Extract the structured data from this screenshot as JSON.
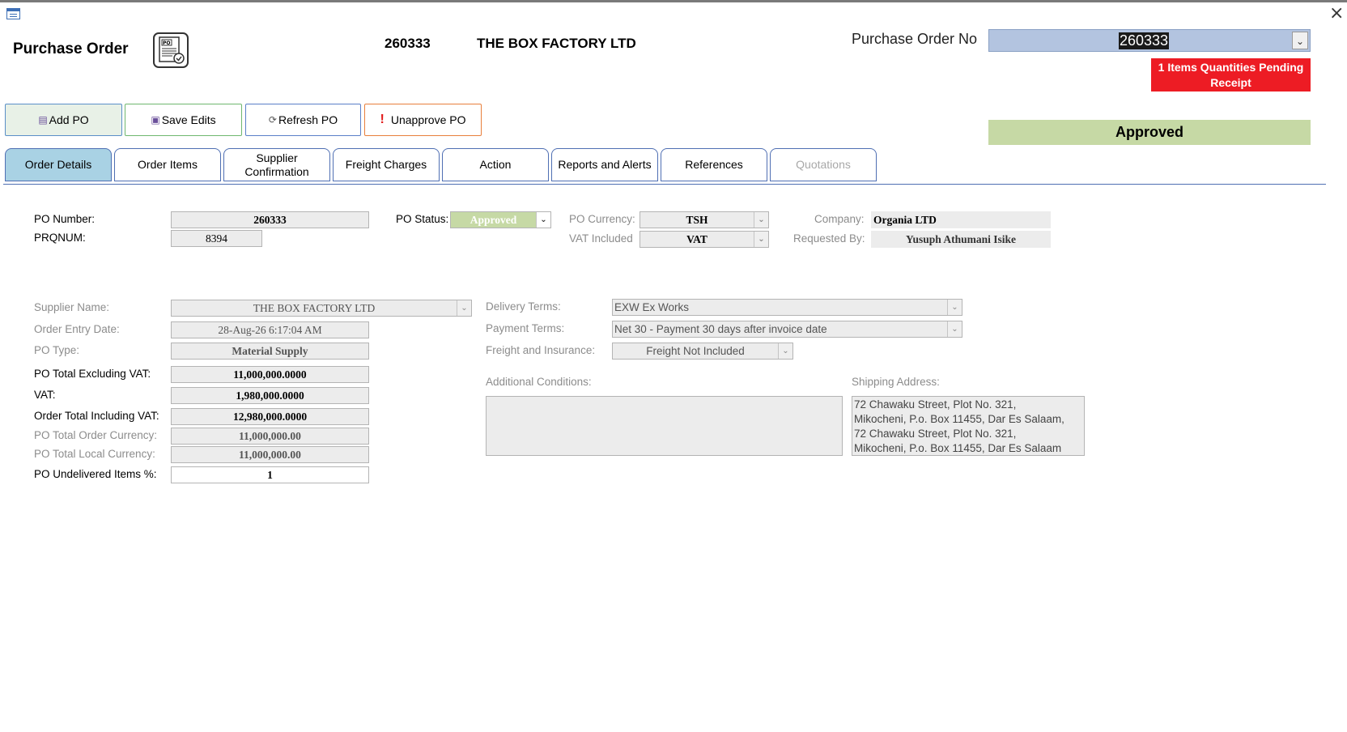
{
  "window": {
    "close_icon": "close-icon"
  },
  "header": {
    "title": "Purchase Order",
    "po_number": "260333",
    "supplier": "THE BOX FACTORY LTD",
    "po_no_label": "Purchase Order No",
    "po_no_value": "260333",
    "pending_alert": "1 Items Quantities Pending Receipt",
    "status_banner": "Approved"
  },
  "toolbar": {
    "add": "Add PO",
    "save": "Save Edits",
    "refresh": "Refresh PO",
    "unapprove": "Unapprove PO"
  },
  "tabs": [
    {
      "label": "Order Details",
      "active": true
    },
    {
      "label": "Order Items"
    },
    {
      "label": "Supplier Confirmation"
    },
    {
      "label": "Freight Charges"
    },
    {
      "label": "Action"
    },
    {
      "label": "Reports and Alerts"
    },
    {
      "label": "References"
    },
    {
      "label": "Quotations",
      "disabled": true
    }
  ],
  "details": {
    "po_number_label": "PO Number:",
    "po_number_value": "260333",
    "prqnum_label": "PRQNUM:",
    "prqnum_value": "8394",
    "po_status_label": "PO Status:",
    "po_status_value": "Approved",
    "po_currency_label": "PO Currency:",
    "po_currency_value": "TSH",
    "vat_included_label": "VAT Included",
    "vat_included_value": "VAT",
    "company_label": "Company:",
    "company_value": "Organia LTD",
    "requested_by_label": "Requested By:",
    "requested_by_value": "Yusuph Athumani Isike",
    "supplier_name_label": "Supplier Name:",
    "supplier_name_value": "THE BOX FACTORY LTD",
    "order_entry_date_label": "Order Entry Date:",
    "order_entry_date_value": "28-Aug-26 6:17:04 AM",
    "po_type_label": "PO Type:",
    "po_type_value": "Material Supply",
    "total_excl_vat_label": "PO Total Excluding VAT:",
    "total_excl_vat_value": "11,000,000.0000",
    "vat_label": "VAT:",
    "vat_value": "1,980,000.0000",
    "total_incl_vat_label": "Order Total Including VAT:",
    "total_incl_vat_value": "12,980,000.0000",
    "total_order_currency_label": "PO Total Order Currency:",
    "total_order_currency_value": "11,000,000.00",
    "total_local_currency_label": "PO Total Local Currency:",
    "total_local_currency_value": "11,000,000.00",
    "undelivered_label": "PO Undelivered Items %:",
    "undelivered_value": "1",
    "delivery_terms_label": "Delivery Terms:",
    "delivery_terms_value": "EXW Ex Works",
    "payment_terms_label": "Payment Terms:",
    "payment_terms_value": "Net 30 - Payment 30 days after invoice date",
    "freight_insurance_label": "Freight and Insurance:",
    "freight_insurance_value": "Freight Not Included",
    "additional_conditions_label": "Additional Conditions:",
    "additional_conditions_value": "",
    "shipping_address_label": "Shipping Address:",
    "shipping_address_value": "72 Chawaku Street, Plot No. 321,\nMikocheni, P.o. Box 11455, Dar Es Salaam,\n72 Chawaku Street, Plot No. 321,\nMikocheni, P.o. Box 11455, Dar Es Salaam"
  },
  "colors": {
    "tab_active": "#a9d2e4",
    "status_green": "#c6d9a5",
    "alert_red": "#ed1c24",
    "combo_blue": "#b3c4e0"
  }
}
